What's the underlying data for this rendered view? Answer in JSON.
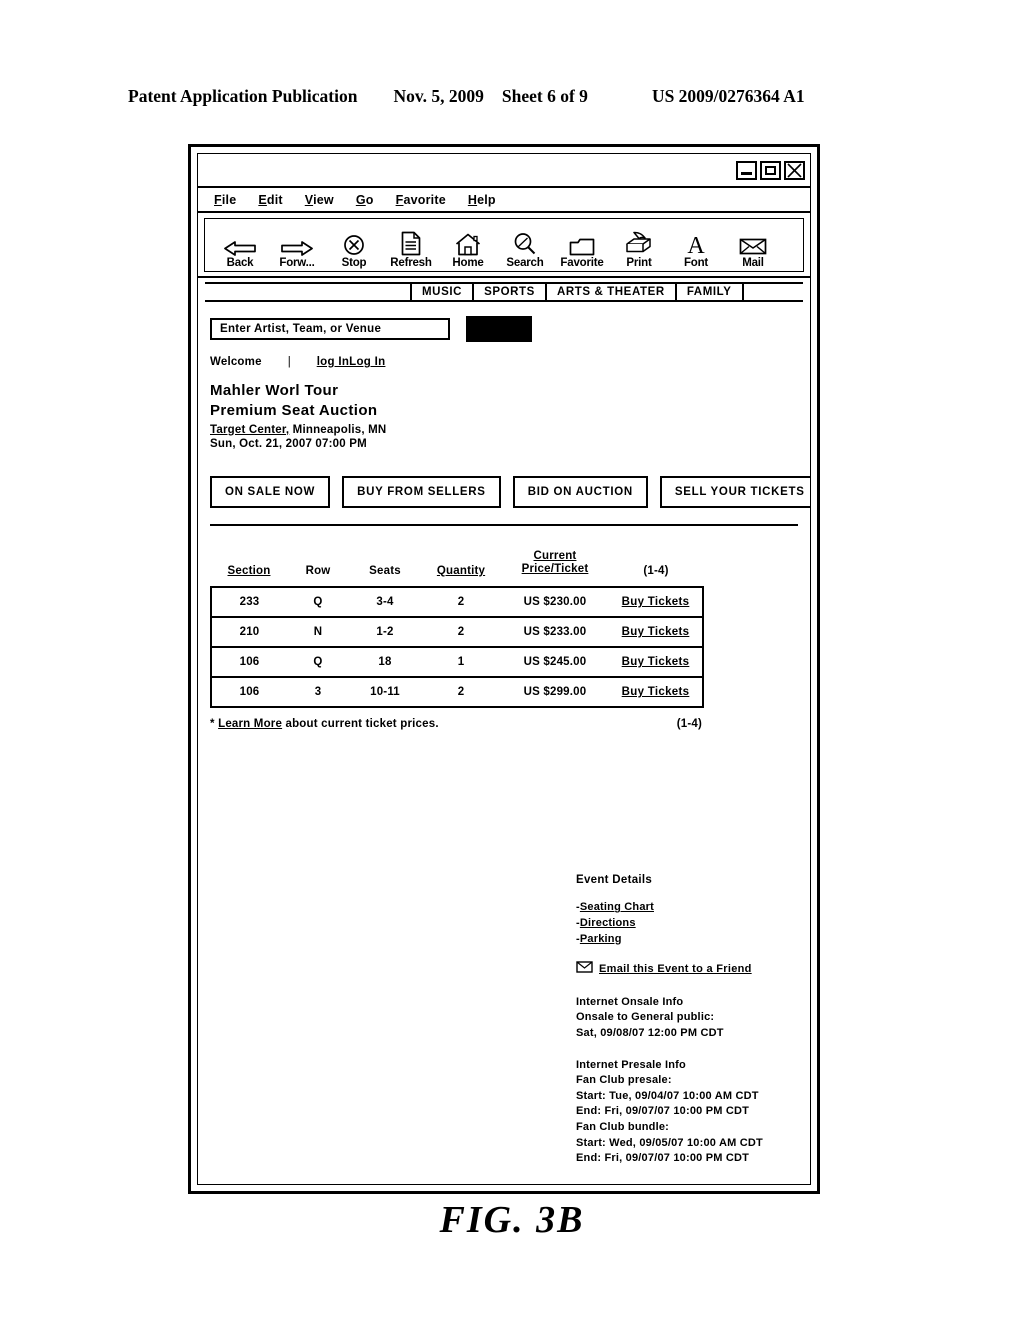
{
  "patent_header": {
    "publication": "Patent Application Publication",
    "date": "Nov. 5, 2009",
    "sheet": "Sheet 6 of 9",
    "number": "US 2009/0276364 A1"
  },
  "figure_caption": "FIG.  3B",
  "window": {
    "controls": [
      {
        "name": "minimize",
        "glyph": "minimize-icon"
      },
      {
        "name": "maximize",
        "glyph": "maximize-icon"
      },
      {
        "name": "close",
        "glyph": "close-icon"
      }
    ]
  },
  "menubar": [
    {
      "accel": "F",
      "rest": "ile"
    },
    {
      "accel": "E",
      "rest": "dit"
    },
    {
      "accel": "V",
      "rest": "iew"
    },
    {
      "accel": "G",
      "rest": "o"
    },
    {
      "accel": "F",
      "rest": "avorite"
    },
    {
      "accel": "H",
      "rest": "elp"
    }
  ],
  "toolbar": [
    {
      "label": "Back",
      "icon": "back-arrow-icon"
    },
    {
      "label": "Forw...",
      "icon": "forward-arrow-icon"
    },
    {
      "label": "Stop",
      "icon": "stop-icon"
    },
    {
      "label": "Refresh",
      "icon": "refresh-document-icon"
    },
    {
      "label": "Home",
      "icon": "home-icon"
    },
    {
      "label": "Search",
      "icon": "search-icon"
    },
    {
      "label": "Favorite",
      "icon": "folder-icon"
    },
    {
      "label": "Print",
      "icon": "printer-icon"
    },
    {
      "label": "Font",
      "icon": "font-icon"
    },
    {
      "label": "Mail",
      "icon": "mail-icon"
    }
  ],
  "nav_tabs": [
    "MUSIC",
    "SPORTS",
    "ARTS & THEATER",
    "FAMILY"
  ],
  "search": {
    "placeholder": "Enter Artist, Team, or Venue",
    "value": "",
    "go_button_label": ""
  },
  "account": {
    "welcome": "Welcome",
    "separator": "|",
    "login_label": "log InLog In"
  },
  "event": {
    "title_line1": "Mahler Worl Tour",
    "title_line2": "Premium Seat Auction",
    "venue_link": "Target Center,",
    "venue_rest": " Minneapolis, MN",
    "datetime": "Sun, Oct. 21, 2007 07:00 PM"
  },
  "actions": [
    "ON SALE NOW",
    "BUY FROM SELLERS",
    "BID ON AUCTION",
    "SELL YOUR TICKETS"
  ],
  "ticket_table": {
    "headers": {
      "section": "Section",
      "row": "Row",
      "seats": "Seats",
      "quantity": "Quantity",
      "price_top": "Current",
      "price_bottom": "Price/Ticket",
      "range": "(1-4)"
    },
    "rows": [
      {
        "section": "233",
        "row": "Q",
        "seats": "3-4",
        "quantity": "2",
        "price": "US  $230.00",
        "action": "Buy Tickets"
      },
      {
        "section": "210",
        "row": "N",
        "seats": "1-2",
        "quantity": "2",
        "price": "US  $233.00",
        "action": "Buy Tickets"
      },
      {
        "section": "106",
        "row": "Q",
        "seats": "18",
        "quantity": "1",
        "price": "US  $245.00",
        "action": "Buy Tickets"
      },
      {
        "section": "106",
        "row": "3",
        "seats": "10-11",
        "quantity": "2",
        "price": "US  $299.00",
        "action": "Buy Tickets"
      }
    ]
  },
  "footnote": {
    "star": "*",
    "link": "Learn More",
    "rest": " about current ticket prices.",
    "range": "(1-4)"
  },
  "event_details": {
    "heading": "Event Details",
    "links": [
      {
        "dash": "-",
        "label": "Seating Chart"
      },
      {
        "dash": "-",
        "label": "Directions"
      },
      {
        "dash": "-",
        "label": "Parking"
      }
    ],
    "email_link": "Email this Event to a Friend",
    "email_icon": "envelope-icon",
    "onsale": {
      "heading": "Internet Onsale Info",
      "subheading": "Onsale to General public:",
      "value": "Sat, 09/08/07 12:00 PM CDT"
    },
    "presale": {
      "heading": "Internet Presale Info",
      "fan_club_presale_label": "Fan Club presale:",
      "fan_club_presale_start": "Start: Tue, 09/04/07 10:00 AM CDT",
      "fan_club_presale_end": "End: Fri, 09/07/07  10:00 PM CDT",
      "fan_club_bundle_label": "Fan Club bundle:",
      "fan_club_bundle_start": "Start: Wed, 09/05/07 10:00 AM CDT",
      "fan_club_bundle_end": "End: Fri, 09/07/07 10:00 PM CDT"
    }
  }
}
